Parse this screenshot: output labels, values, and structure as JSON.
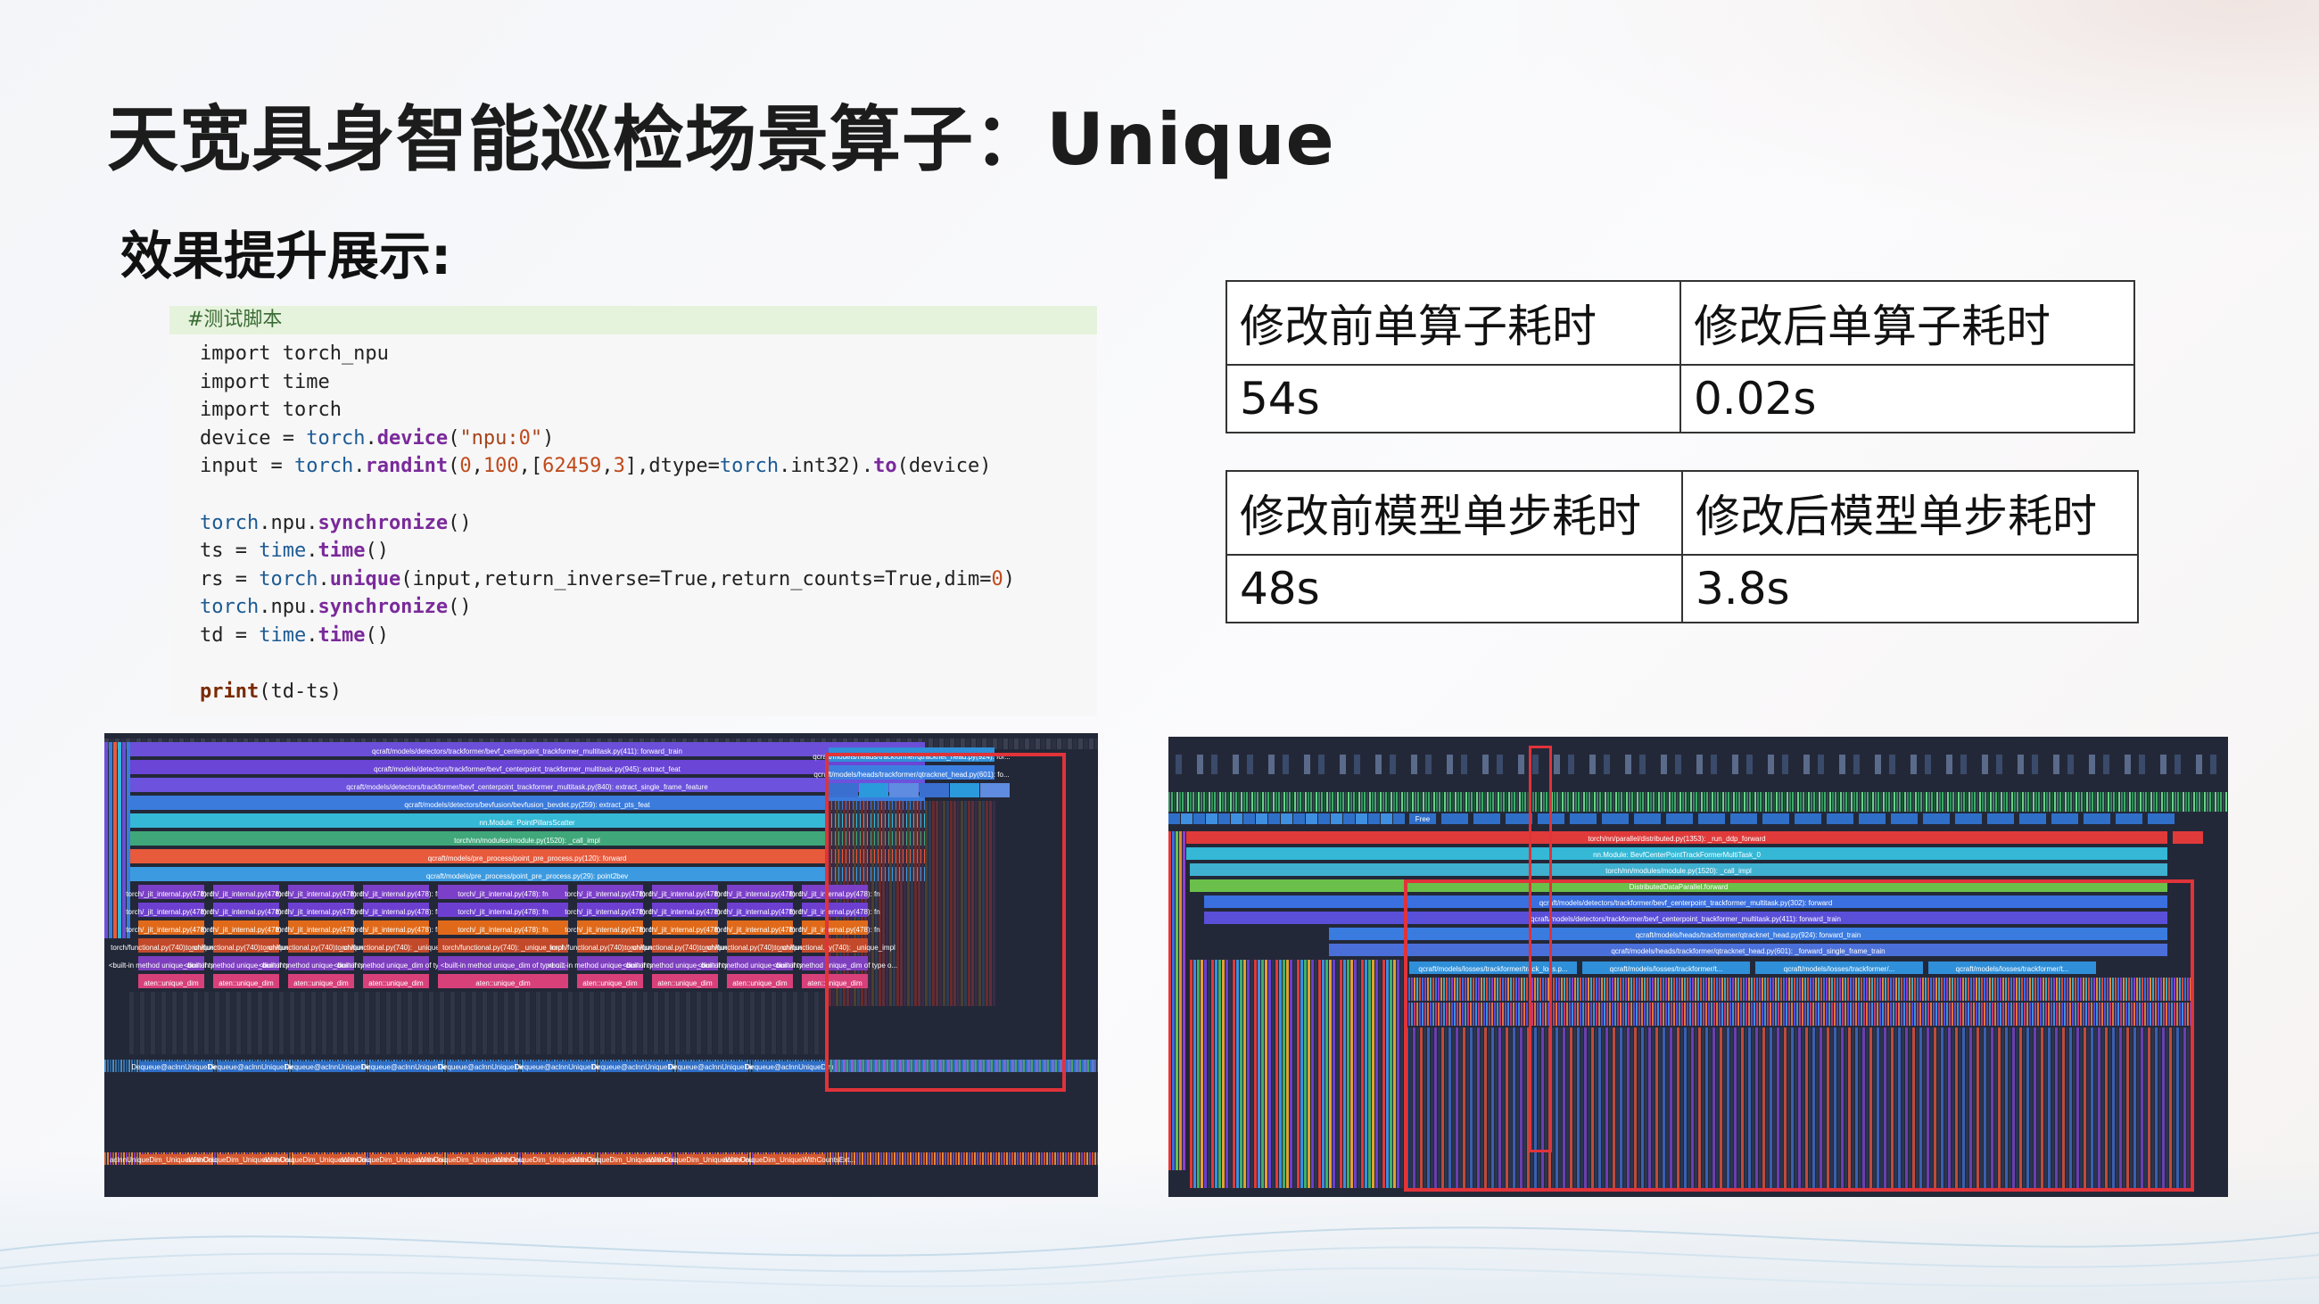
{
  "title": "天宽具身智能巡检场景算子：Unique",
  "subtitle": "效果提升展示:",
  "code": {
    "comment": "#测试脚本",
    "lines": [
      "import torch_npu",
      "import time",
      "import torch",
      "device = torch.device(\"npu:0\")",
      "input = torch.randint(0,100,[62459,3],dtype=torch.int32).to(device)",
      "",
      "torch.npu.synchronize()",
      "ts = time.time()",
      "rs = torch.unique(input,return_inverse=True,return_counts=True,dim=0)",
      "torch.npu.synchronize()",
      "td = time.time()",
      "",
      "print(td-ts)"
    ]
  },
  "table_operator": {
    "headers": [
      "修改前单算子耗时",
      "修改后单算子耗时"
    ],
    "values": [
      "54s",
      "0.02s"
    ]
  },
  "table_model": {
    "headers": [
      "修改前模型单步耗时",
      "修改后模型单步耗时"
    ],
    "values": [
      "48s",
      "3.8s"
    ]
  },
  "profiler_left": {
    "rows": [
      "qcraft/models/detectors/trackformer/bevf_centerpoint_trackformer_multitask.py(411): forward_train",
      "qcraft/models/detectors/trackformer/bevf_centerpoint_trackformer_multitask.py(945): extract_feat",
      "qcraft/models/detectors/trackformer/bevf_centerpoint_trackformer_multitask.py(840): extract_single_frame_feature",
      "qcraft/models/detectors/bevfusion/bevfusion_bevdet.py(259): extract_pts_feat",
      "nn.Module: PointPillarsScatter",
      "torch/nn/modules/module.py(1520): _call_impl",
      "qcraft/models/pre_process/point_pre_process.py(120): forward",
      "qcraft/models/pre_process/point_pre_process.py(29): point2bev"
    ],
    "right_labels": [
      "qcraft/models/heads/trackformer/qtracknet_head.py(924): for...",
      "qcraft/models/heads/trackformer/qtracknet_head.py(601): fo..."
    ],
    "ops": [
      "torch/_jit_internal.py(478): fn",
      "torch/functional.py(740): _unique_impl",
      "<built-in method unique_dim of type o...",
      "aten::unique_dim"
    ],
    "dequeue": "Dequeue@aclnnUniqueDim",
    "aclnn": "aclnnUniqueDim_UniqueWithCountsExt..."
  },
  "profiler_right": {
    "rows": [
      "torch/nn/parallel/distributed.py(1353): _run_ddp_forward",
      "nn.Module: BevfCenterPointTrackFormerMultiTask_0",
      "torch/nn/modules/module.py(1520): _call_impl",
      "DistributedDataParallel.forward",
      "qcraft/models/detectors/trackformer/bevf_centerpoint_trackformer_multitask.py(302): forward",
      "qcraft/models/detectors/trackformer/bevf_centerpoint_trackformer_multitask.py(411): forward_train",
      "qcraft/models/heads/trackformer/qtracknet_head.py(924): forward_train",
      "qcraft/models/heads/trackformer/qtracknet_head.py(601): _forward_single_frame_train"
    ],
    "losses": [
      "qcraft/models/losses/trackformer/track_loss.p...",
      "qcraft/models/losses/trackformer/t...",
      "qcraft/models/losses/trackformer/...",
      "qcraft/models/losses/trackformer/t..."
    ],
    "free_label": "Free"
  },
  "colors": {
    "highlight": "#e0333a",
    "profiler_bg": "#232838"
  }
}
